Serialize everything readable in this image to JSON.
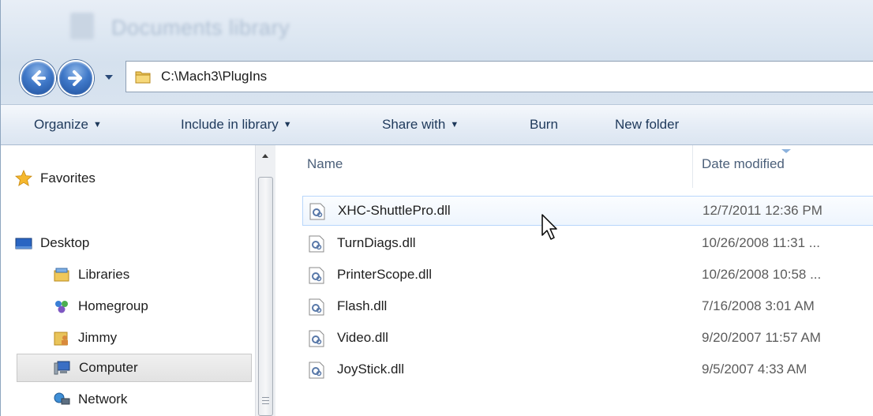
{
  "window": {
    "ghost_title": "Documents library"
  },
  "address": {
    "path": "C:\\Mach3\\PlugIns"
  },
  "commands": [
    {
      "label": "Organize",
      "caret": "▼"
    },
    {
      "label": "Include in library",
      "caret": "▼"
    },
    {
      "label": "Share with",
      "caret": "▼"
    },
    {
      "label": "Burn",
      "caret": ""
    },
    {
      "label": "New folder",
      "caret": ""
    }
  ],
  "navigation": {
    "favorites": "Favorites",
    "desktop": "Desktop",
    "libraries": "Libraries",
    "homegroup": "Homegroup",
    "jimmy": "Jimmy",
    "computer": "Computer",
    "network": "Network"
  },
  "columns": {
    "name": "Name",
    "date_modified": "Date modified"
  },
  "files": [
    {
      "name": "XHC-ShuttlePro.dll",
      "date": "12/7/2011 12:36 PM"
    },
    {
      "name": "TurnDiags.dll",
      "date": "10/26/2008 11:31 ..."
    },
    {
      "name": "PrinterScope.dll",
      "date": "10/26/2008 10:58 ..."
    },
    {
      "name": "Flash.dll",
      "date": "7/16/2008 3:01 AM"
    },
    {
      "name": "Video.dll",
      "date": "9/20/2007 11:57 AM"
    },
    {
      "name": "JoyStick.dll",
      "date": "9/5/2007 4:33 AM"
    }
  ],
  "icons": {
    "back": "back-arrow-icon",
    "forward": "forward-arrow-icon",
    "folder": "folder-icon",
    "dll": "dll-file-icon",
    "star": "star-icon"
  },
  "colors": {
    "accent_blue": "#3f78c8",
    "command_text": "#1e395b",
    "hover_border": "#b8d6fb"
  }
}
